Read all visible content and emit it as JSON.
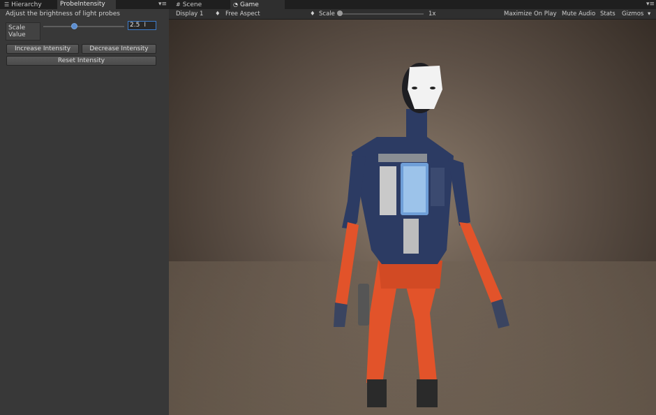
{
  "left_panel": {
    "tabs": [
      {
        "label": "Hierarchy",
        "icon": "list-icon"
      },
      {
        "label": "ProbeIntensity",
        "icon": ""
      }
    ],
    "help_text": "Adjust the brightness of light probes",
    "scale_field": {
      "label": "Scale\nValue",
      "value": "2.5",
      "slider_fraction": 0.39
    },
    "buttons": {
      "increase": "Increase Intensity",
      "decrease": "Decrease Intensity",
      "reset": "Reset Intensity"
    }
  },
  "game_panel": {
    "tabs": [
      {
        "label": "Scene",
        "icon": "grid-icon"
      },
      {
        "label": "Game",
        "icon": "pacman-icon"
      }
    ],
    "toolbar": {
      "display": "Display 1",
      "aspect": "Free Aspect",
      "scale_label": "Scale",
      "scale_value": "1x",
      "maximize": "Maximize On Play",
      "mute": "Mute Audio",
      "stats": "Stats",
      "gizmos": "Gizmos"
    }
  },
  "colors": {
    "accent": "#3d7ccb",
    "panel": "#383838",
    "robot_orange": "#e2532a",
    "robot_blue": "#2c3b63"
  }
}
